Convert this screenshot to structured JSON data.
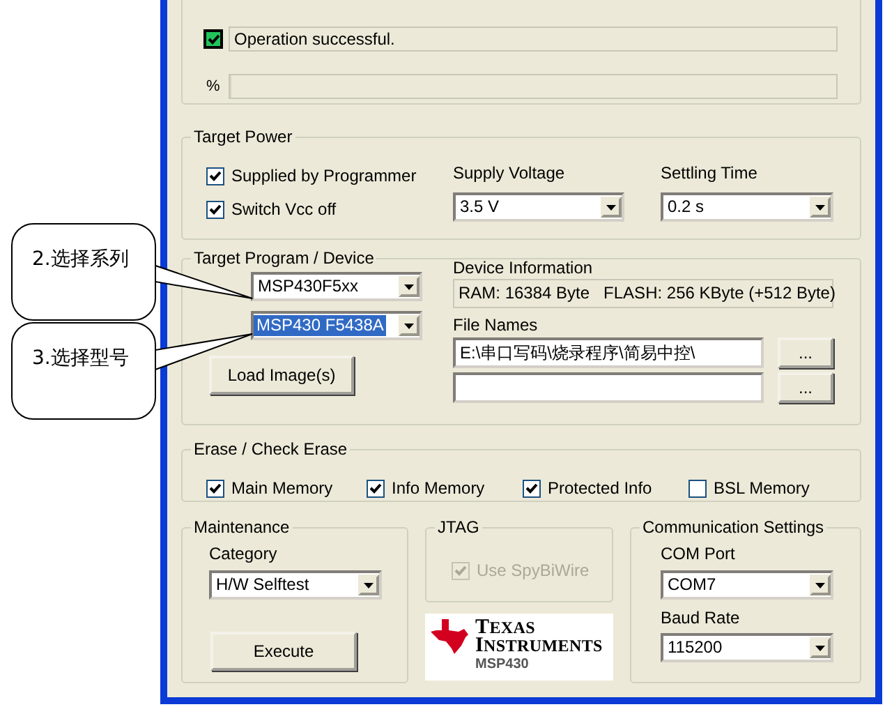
{
  "status": {
    "success": true,
    "message": "Operation successful.",
    "progress_label": "%",
    "level": 0
  },
  "target_power": {
    "title": "Target Power",
    "checkboxes": [
      {
        "label": "Supplied by Programmer",
        "checked": true
      },
      {
        "label": "Switch Vcc off",
        "checked": true
      }
    ],
    "supply_voltage": {
      "label": "Supply Voltage",
      "value": "3.5 V"
    },
    "settling_time": {
      "label": "Settling Time",
      "value": "0.2 s"
    }
  },
  "target_device": {
    "title": "Target Program / Device",
    "family": {
      "value": "MSP430F5xx",
      "focused": false
    },
    "type": {
      "value": "MSP430 F5438A",
      "focused": true
    },
    "load_button": "Load Image(s)",
    "device_info": {
      "label": "Device Information",
      "value": "RAM: 16384 Byte   FLASH: 256 KByte (+512 Byte)"
    },
    "file_names": {
      "label": "File Names",
      "rows": [
        {
          "value": "E:\\串口写码\\烧录程序\\简易中控\\",
          "button": "..."
        },
        {
          "button": "..."
        }
      ]
    }
  },
  "erase": {
    "title": "Erase / Check Erase",
    "options": [
      {
        "label": "Main Memory",
        "checked": true
      },
      {
        "label": "Info Memory",
        "checked": true
      },
      {
        "label": "Protected Info",
        "checked": true
      },
      {
        "label": "BSL Memory",
        "checked": false
      }
    ]
  },
  "maintenance": {
    "title": "Maintenance",
    "category": {
      "label": "Category",
      "value": "H/W Selftest"
    },
    "execute_button": "Execute"
  },
  "jtag": {
    "title": "JTAG",
    "checkbox": {
      "label": "Use SpyBiWire",
      "checked": true,
      "disabled": true
    }
  },
  "logo": {
    "line1": "TEXAS",
    "line2": "INSTRUMENTS",
    "product": "MSP430"
  },
  "communication": {
    "title": "Communication Settings",
    "com_port": {
      "label": "COM Port",
      "value": "COM7"
    },
    "baud_rate": {
      "label": "Baud Rate",
      "value": "115200"
    }
  },
  "callouts": [
    {
      "text": "2.选择系列"
    },
    {
      "text": "3.选择型号"
    }
  ]
}
